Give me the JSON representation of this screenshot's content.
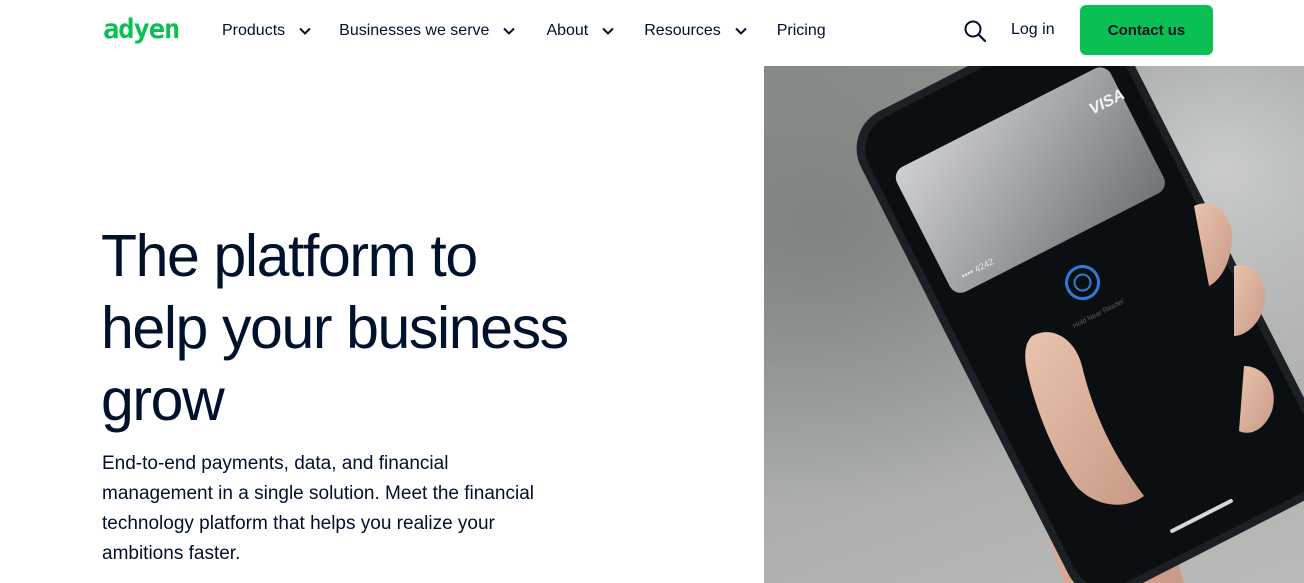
{
  "brand": {
    "logo_text": "adyen",
    "accent_color": "#0abf53",
    "text_color": "#00112c"
  },
  "nav": {
    "items": [
      {
        "label": "Products",
        "has_dropdown": true
      },
      {
        "label": "Businesses we serve",
        "has_dropdown": true
      },
      {
        "label": "About",
        "has_dropdown": true
      },
      {
        "label": "Resources",
        "has_dropdown": true
      },
      {
        "label": "Pricing",
        "has_dropdown": false
      }
    ],
    "search_icon": "search-icon",
    "login_label": "Log in",
    "cta_label": "Contact us"
  },
  "hero": {
    "title_lines": [
      "The platform to",
      "help your business",
      "grow"
    ],
    "description_lines": [
      "End-to-end payments, data, and financial",
      "management in a single solution. Meet the financial",
      "technology platform that helps you realize your",
      "ambitions faster."
    ],
    "image": {
      "card_brand_text": "VISA",
      "card_number_text": "•••• 4242",
      "prompt_text": "Hold Near Reader"
    }
  }
}
